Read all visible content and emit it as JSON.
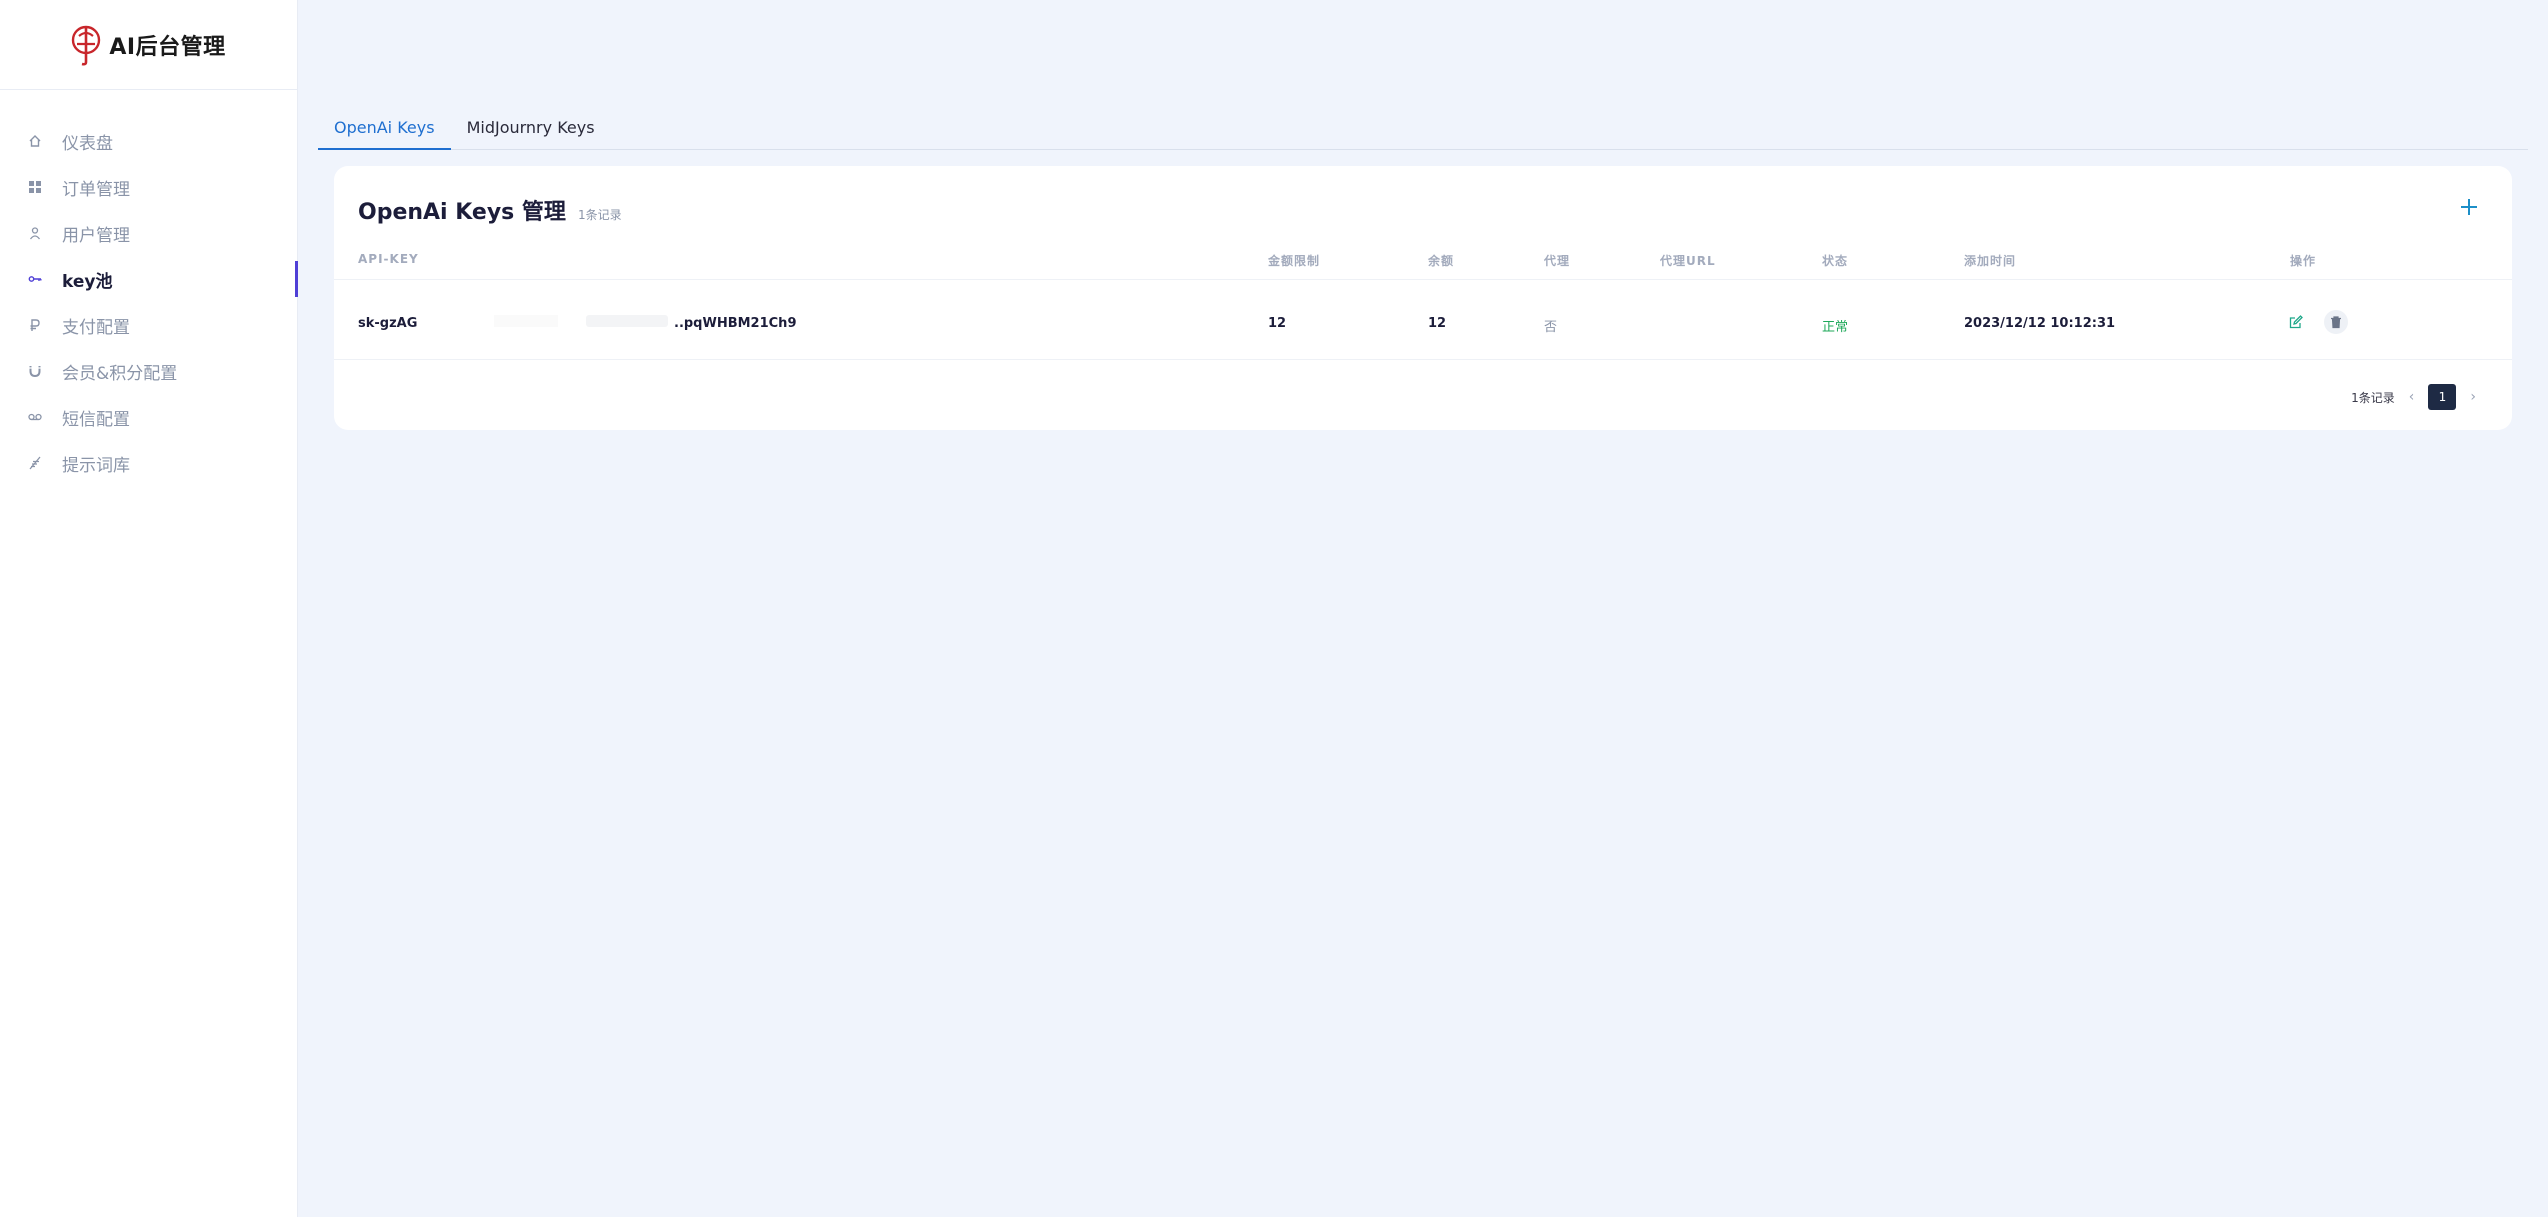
{
  "app": {
    "title": "AI后台管理"
  },
  "sidebar": {
    "items": [
      {
        "label": "仪表盘",
        "icon": "home-icon"
      },
      {
        "label": "订单管理",
        "icon": "grid-icon"
      },
      {
        "label": "用户管理",
        "icon": "user-icon"
      },
      {
        "label": "key池",
        "icon": "key-icon",
        "active": true
      },
      {
        "label": "支付配置",
        "icon": "ruble-icon"
      },
      {
        "label": "会员&积分配置",
        "icon": "magnet-icon"
      },
      {
        "label": "短信配置",
        "icon": "voicemail-icon"
      },
      {
        "label": "提示词库",
        "icon": "feather-icon"
      }
    ]
  },
  "tabs": [
    {
      "label": "OpenAi Keys",
      "active": true
    },
    {
      "label": "MidJournry Keys"
    }
  ],
  "card": {
    "title": "OpenAi Keys 管理",
    "count": "1条记录",
    "add_icon": "plus-icon"
  },
  "table": {
    "headers": {
      "api_key": "API-KEY",
      "limit": "金额限制",
      "balance": "余额",
      "proxy": "代理",
      "proxy_url": "代理URL",
      "status": "状态",
      "added": "添加时间",
      "ops": "操作"
    },
    "rows": [
      {
        "api_key_start": "sk-gzAG",
        "api_key_end": "..pqWHBM21Ch9",
        "limit": "12",
        "balance": "12",
        "proxy": "否",
        "proxy_url": "",
        "status": "正常",
        "added": "2023/12/12 10:12:31"
      }
    ]
  },
  "pagination": {
    "total": "1条记录",
    "current": "1"
  },
  "colors": {
    "accent": "#1f6fd0",
    "active_bar": "#4f3fd6",
    "status_ok": "#1fa85a",
    "add": "#1d8fc8",
    "page_active": "#1e2a44"
  }
}
